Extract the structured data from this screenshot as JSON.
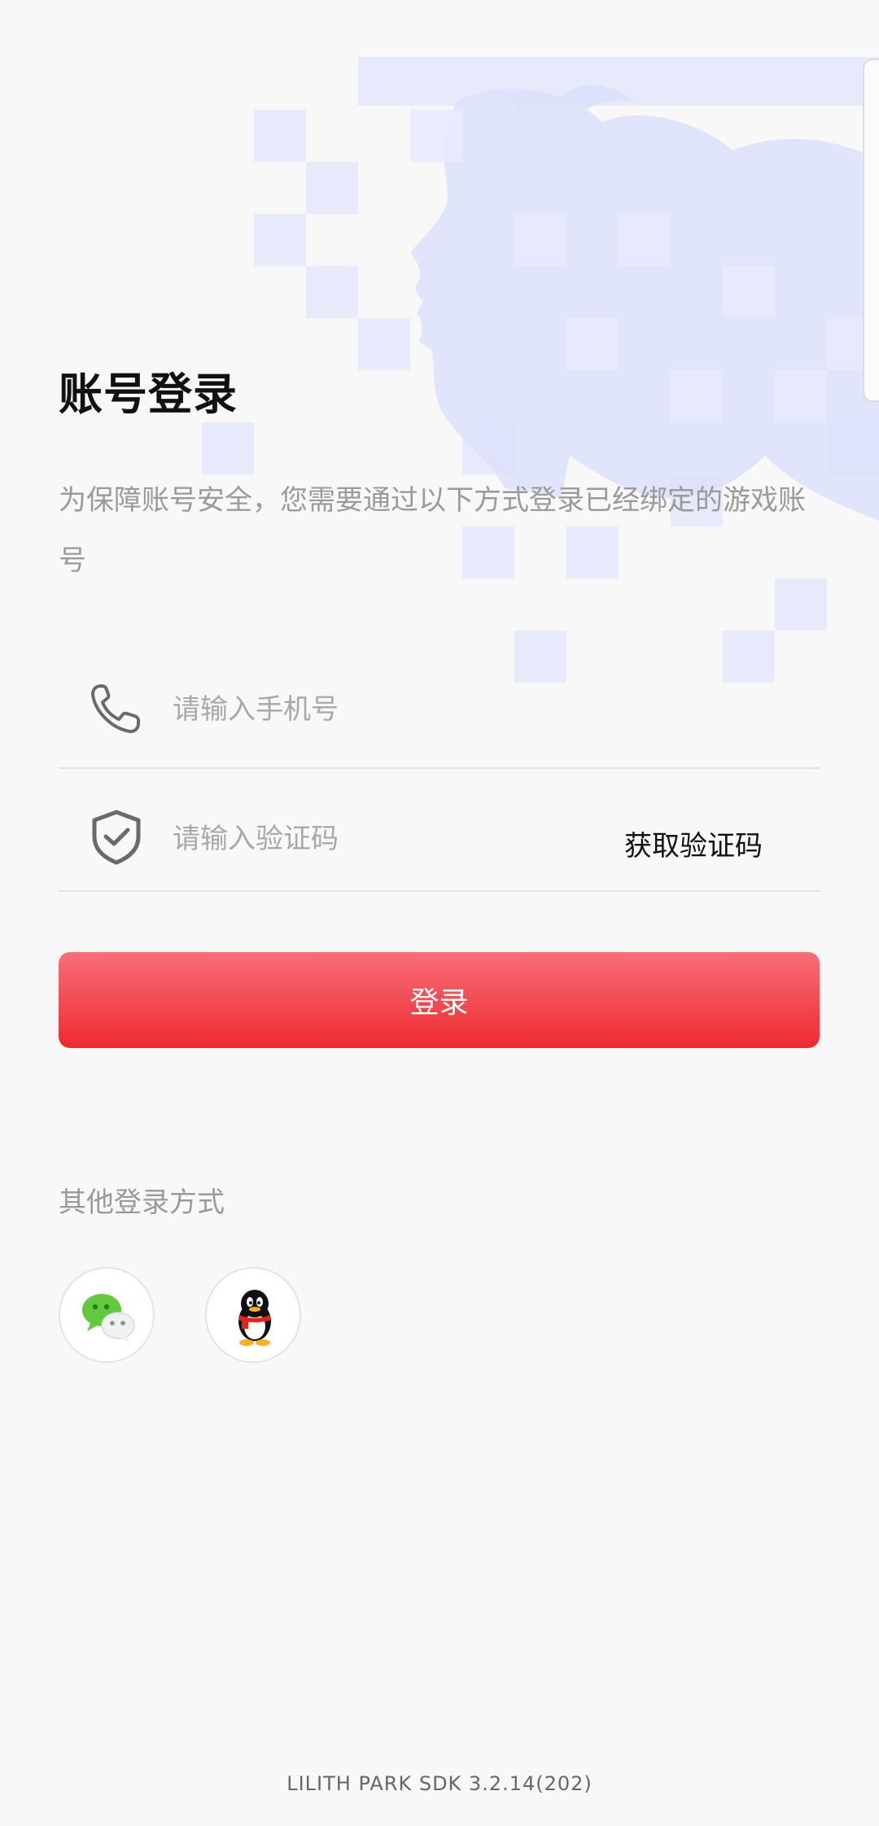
{
  "login": {
    "title": "账号登录",
    "description": "为保障账号安全，您需要通过以下方式登录已经绑定的游戏账号",
    "phone_placeholder": "请输入手机号",
    "code_placeholder": "请输入验证码",
    "get_code_label": "获取验证码",
    "submit_label": "登录"
  },
  "other": {
    "label": "其他登录方式",
    "methods": [
      {
        "icon": "wechat-icon"
      },
      {
        "icon": "qq-icon"
      }
    ]
  },
  "footer": {
    "version": "LILITH PARK SDK 3.2.14(202)"
  },
  "colors": {
    "accent_top": "#f86f78",
    "accent_bottom": "#ec2a30",
    "background": "#f8f8f8",
    "bg_art": "#d6dcfb"
  }
}
